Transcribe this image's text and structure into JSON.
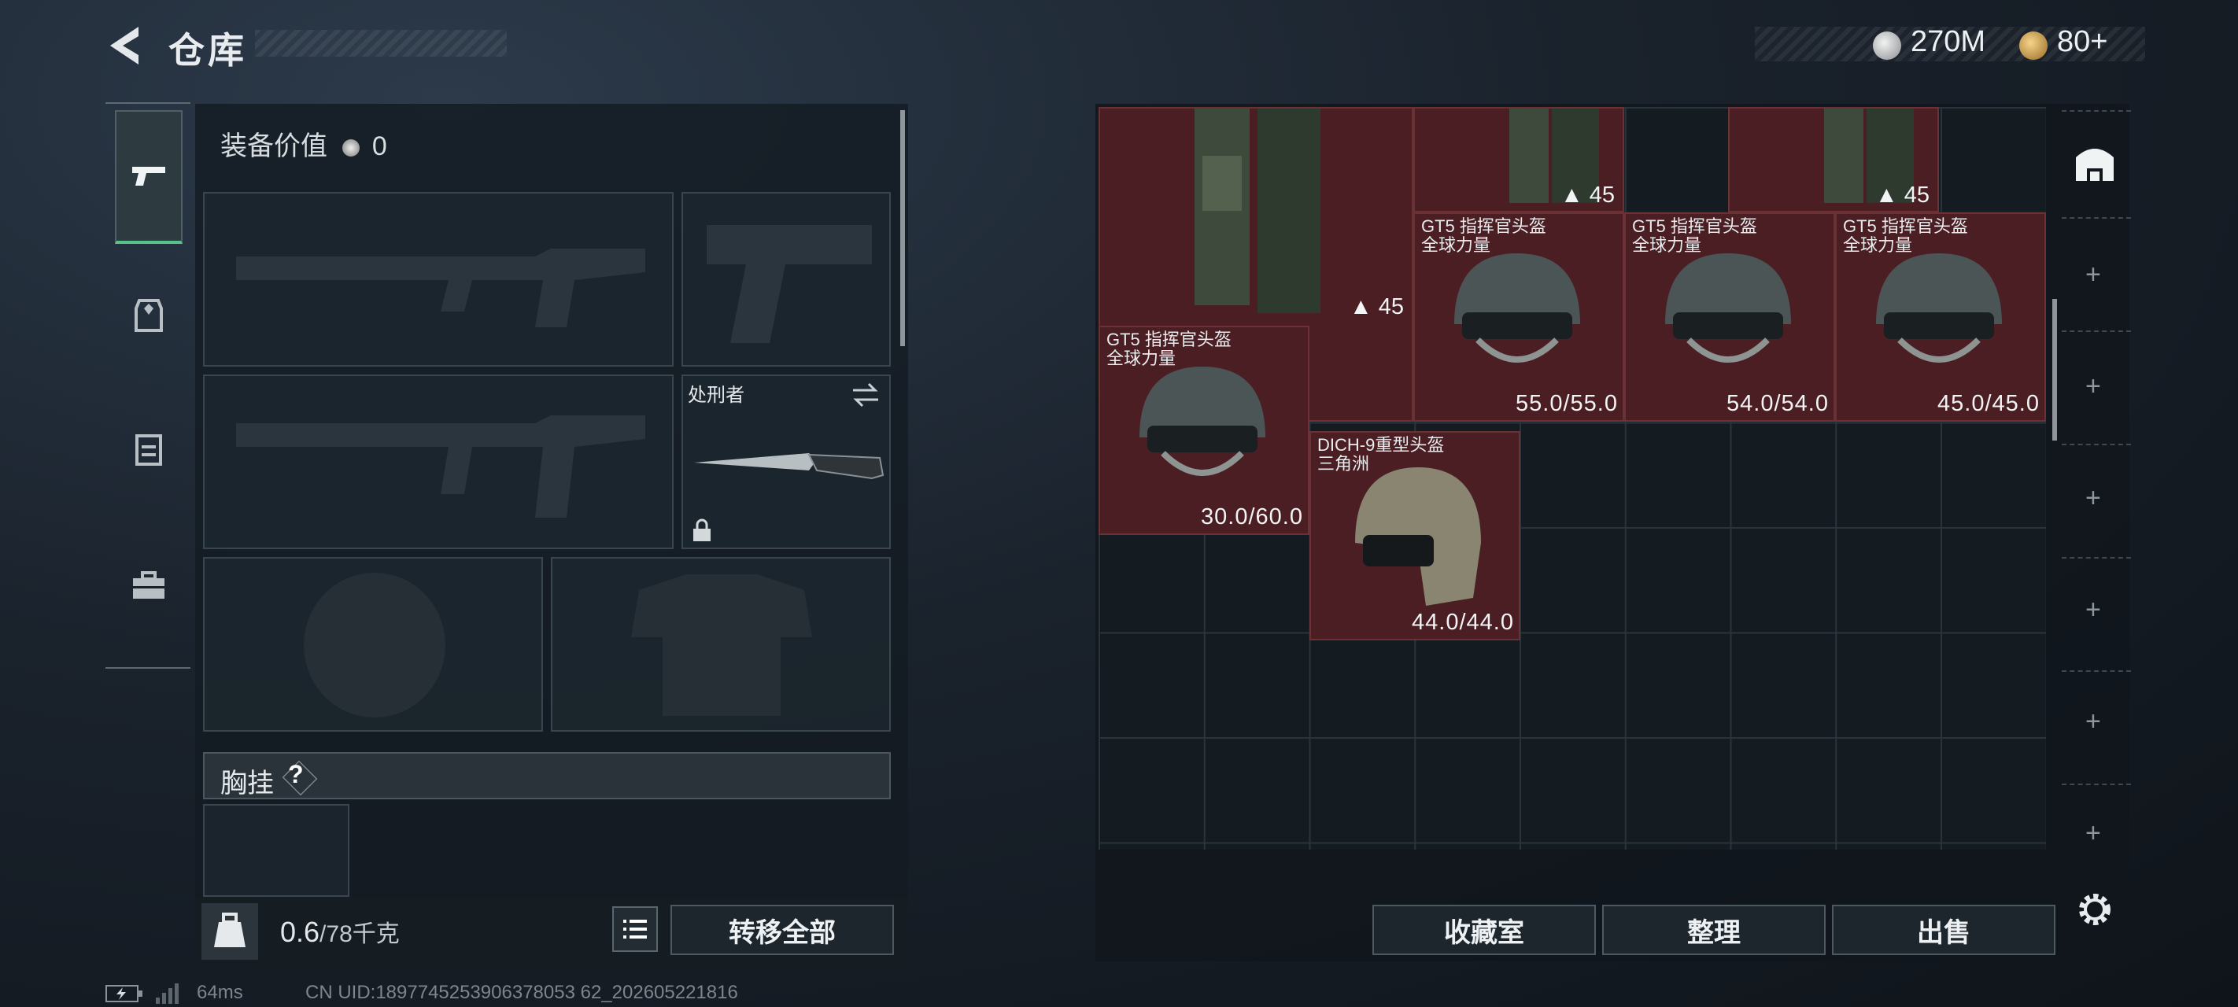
{
  "header": {
    "title": "仓库"
  },
  "currency": {
    "silver": "270M",
    "gold": "80+"
  },
  "left_tabs": [
    "weapon-tab",
    "armor-tab",
    "vest-tab",
    "case-tab"
  ],
  "equipment": {
    "value_label": "装备价值",
    "value": "0",
    "melee_name": "处刑者",
    "chest_label": "胸挂",
    "help_mark": "?"
  },
  "capacity": {
    "value": "0.6",
    "max": "/78",
    "unit": "千克"
  },
  "buttons": {
    "transfer_all": "转移全部",
    "collection": "收藏室",
    "organize": "整理",
    "sell": "出售"
  },
  "storage_items": [
    {
      "kind": "backpack",
      "capacity": "45"
    },
    {
      "kind": "backpack",
      "capacity": "45"
    },
    {
      "kind": "backpack",
      "capacity": "45"
    },
    {
      "name1": "GT5 指挥官头盔",
      "name2": "全球力量",
      "durability": "55.0/55.0"
    },
    {
      "name1": "GT5 指挥官头盔",
      "name2": "全球力量",
      "durability": "54.0/54.0"
    },
    {
      "name1": "GT5 指挥官头盔",
      "name2": "全球力量",
      "durability": "45.0/45.0"
    },
    {
      "name1": "GT5 指挥官头盔",
      "name2": "全球力量",
      "durability": "30.0/60.0"
    },
    {
      "name1": "DICH-9重型头盔",
      "name2": "三角洲",
      "durability": "44.0/44.0"
    }
  ],
  "side_slots": {
    "plus": "+"
  },
  "status_bar": {
    "ping": "64ms",
    "uid": "CN UID:1897745253906378053 62_202605221816"
  }
}
